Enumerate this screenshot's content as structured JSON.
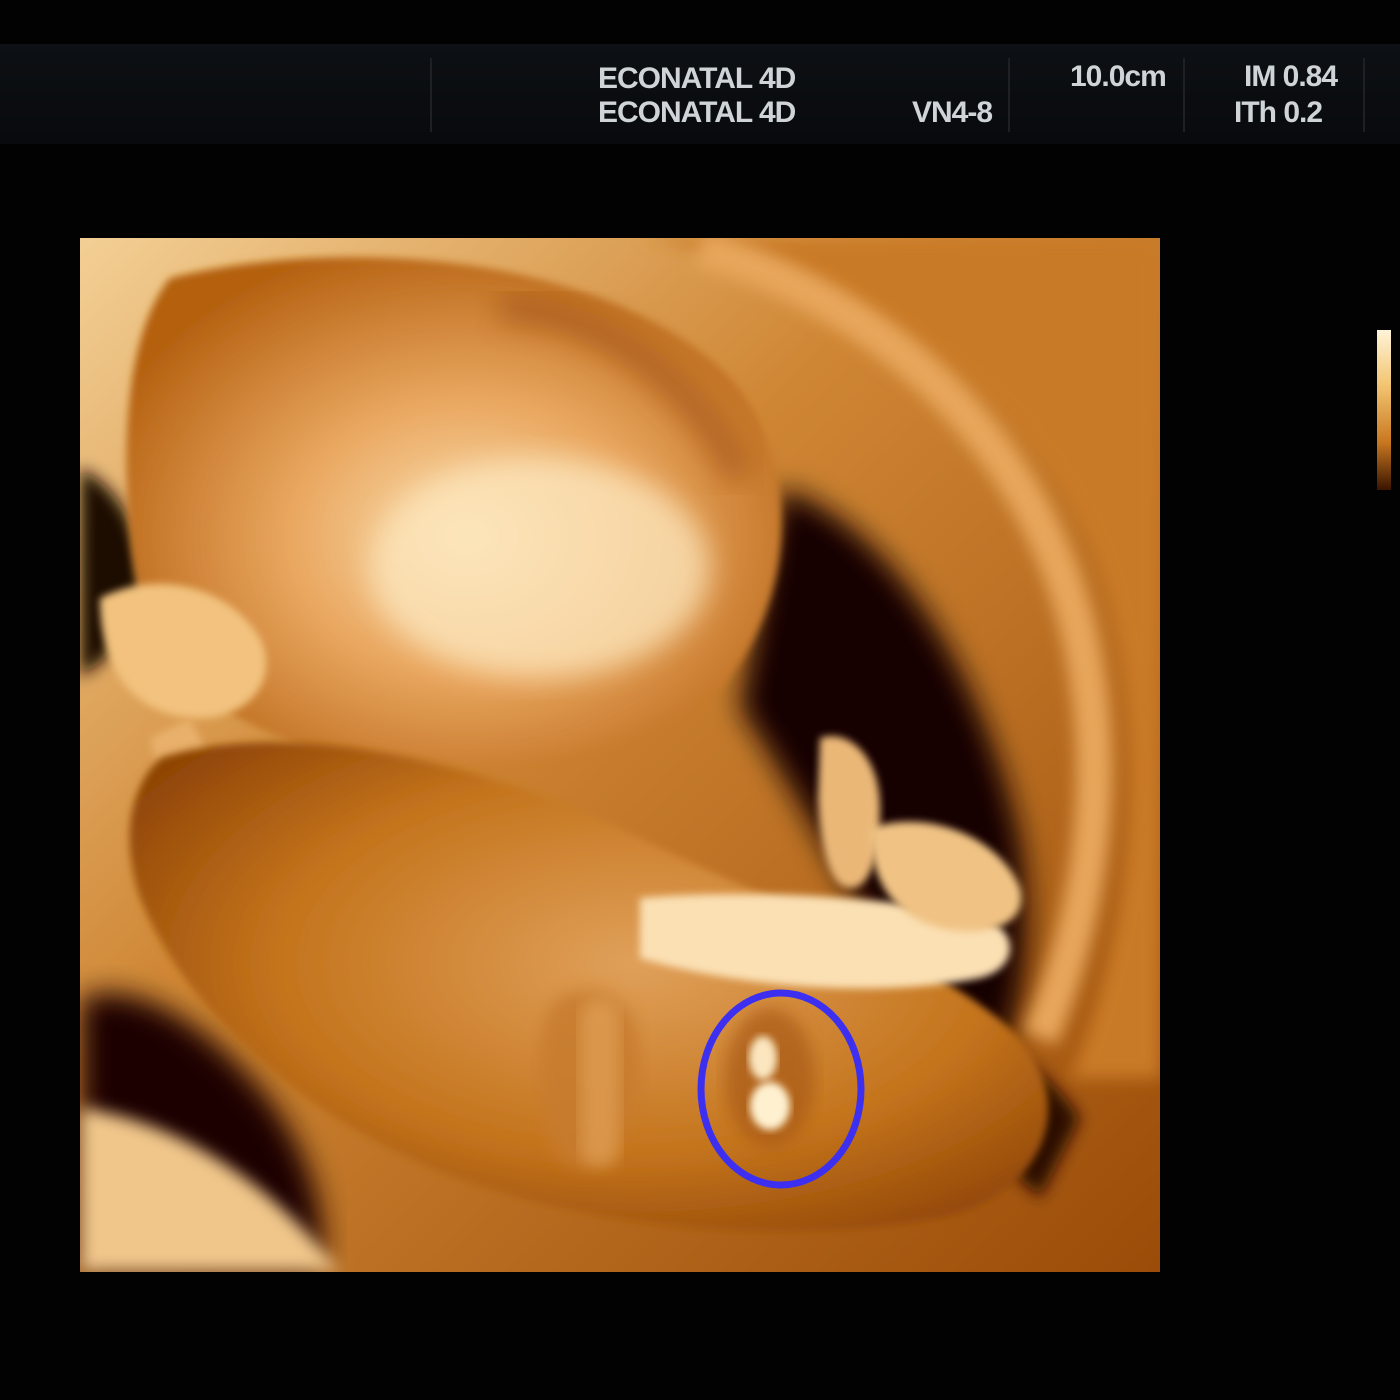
{
  "header": {
    "preset_line_1": "ECONATAL 4D",
    "preset_line_2": "ECONATAL 4D",
    "probe": "VN4-8",
    "depth": "10.0cm",
    "mechanical_index": "IM 0.84",
    "thermal_index": "ITh 0.2"
  },
  "image": {
    "rendering_tint": "#c9700f",
    "annotation_color": "#3c2ff0",
    "annotation_shape": "circle"
  },
  "icons": {
    "gray_scale_bar": "gray-scale-bar"
  }
}
